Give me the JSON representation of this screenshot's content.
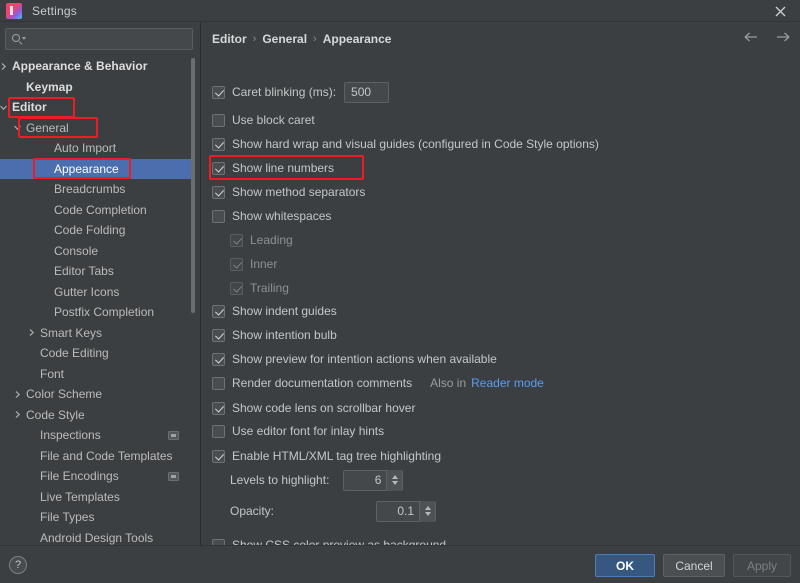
{
  "window": {
    "title": "Settings",
    "app_icon": "intellij-idea-icon",
    "close_icon": "close-icon"
  },
  "colors": {
    "background": "#3c3f41",
    "selection": "#4b6eaf",
    "accent_primary": "#365880",
    "link": "#589df6",
    "annotation": "#ee1c25",
    "text": "#c4c7c9"
  },
  "search": {
    "value": "",
    "placeholder": "",
    "icon": "search-icon"
  },
  "sidebar": {
    "items": [
      {
        "label": "Appearance & Behavior",
        "indent": 0,
        "chevron": "right",
        "bold": true,
        "selected": false,
        "badge": false
      },
      {
        "label": "Keymap",
        "indent": 1,
        "chevron": "",
        "bold": true,
        "selected": false,
        "badge": false
      },
      {
        "label": "Editor",
        "indent": 0,
        "chevron": "down",
        "bold": true,
        "selected": false,
        "badge": false
      },
      {
        "label": "General",
        "indent": 1,
        "chevron": "down",
        "bold": false,
        "selected": false,
        "badge": false
      },
      {
        "label": "Auto Import",
        "indent": 3,
        "chevron": "",
        "bold": false,
        "selected": false,
        "badge": false
      },
      {
        "label": "Appearance",
        "indent": 3,
        "chevron": "",
        "bold": false,
        "selected": true,
        "badge": false
      },
      {
        "label": "Breadcrumbs",
        "indent": 3,
        "chevron": "",
        "bold": false,
        "selected": false,
        "badge": false
      },
      {
        "label": "Code Completion",
        "indent": 3,
        "chevron": "",
        "bold": false,
        "selected": false,
        "badge": false
      },
      {
        "label": "Code Folding",
        "indent": 3,
        "chevron": "",
        "bold": false,
        "selected": false,
        "badge": false
      },
      {
        "label": "Console",
        "indent": 3,
        "chevron": "",
        "bold": false,
        "selected": false,
        "badge": false
      },
      {
        "label": "Editor Tabs",
        "indent": 3,
        "chevron": "",
        "bold": false,
        "selected": false,
        "badge": false
      },
      {
        "label": "Gutter Icons",
        "indent": 3,
        "chevron": "",
        "bold": false,
        "selected": false,
        "badge": false
      },
      {
        "label": "Postfix Completion",
        "indent": 3,
        "chevron": "",
        "bold": false,
        "selected": false,
        "badge": false
      },
      {
        "label": "Smart Keys",
        "indent": 2,
        "chevron": "right",
        "bold": false,
        "selected": false,
        "badge": false
      },
      {
        "label": "Code Editing",
        "indent": 2,
        "chevron": "",
        "bold": false,
        "selected": false,
        "badge": false
      },
      {
        "label": "Font",
        "indent": 2,
        "chevron": "",
        "bold": false,
        "selected": false,
        "badge": false
      },
      {
        "label": "Color Scheme",
        "indent": 1,
        "chevron": "right",
        "bold": false,
        "selected": false,
        "badge": false
      },
      {
        "label": "Code Style",
        "indent": 1,
        "chevron": "right",
        "bold": false,
        "selected": false,
        "badge": false
      },
      {
        "label": "Inspections",
        "indent": 2,
        "chevron": "",
        "bold": false,
        "selected": false,
        "badge": true
      },
      {
        "label": "File and Code Templates",
        "indent": 2,
        "chevron": "",
        "bold": false,
        "selected": false,
        "badge": false
      },
      {
        "label": "File Encodings",
        "indent": 2,
        "chevron": "",
        "bold": false,
        "selected": false,
        "badge": true
      },
      {
        "label": "Live Templates",
        "indent": 2,
        "chevron": "",
        "bold": false,
        "selected": false,
        "badge": false
      },
      {
        "label": "File Types",
        "indent": 2,
        "chevron": "",
        "bold": false,
        "selected": false,
        "badge": false
      },
      {
        "label": "Android Design Tools",
        "indent": 2,
        "chevron": "",
        "bold": false,
        "selected": false,
        "badge": false
      }
    ]
  },
  "breadcrumb": {
    "parts": [
      "Editor",
      "General",
      "Appearance"
    ],
    "separator": "›"
  },
  "nav": {
    "back_icon": "arrow-left-icon",
    "forward_icon": "arrow-right-icon"
  },
  "settings": {
    "rows": [
      {
        "id": "caret-blinking",
        "label": "Caret blinking (ms):",
        "checked": true,
        "enabled": true,
        "indent": 0,
        "control": "text",
        "value": "500"
      },
      {
        "id": "use-block-caret",
        "label": "Use block caret",
        "checked": false,
        "enabled": true,
        "indent": 0,
        "control": "none",
        "value": ""
      },
      {
        "id": "show-hard-wrap",
        "label": "Show hard wrap and visual guides (configured in Code Style options)",
        "checked": true,
        "enabled": true,
        "indent": 0,
        "control": "none",
        "value": ""
      },
      {
        "id": "show-line-numbers",
        "label": "Show line numbers",
        "checked": true,
        "enabled": true,
        "indent": 0,
        "control": "none",
        "value": ""
      },
      {
        "id": "show-method-separators",
        "label": "Show method separators",
        "checked": true,
        "enabled": true,
        "indent": 0,
        "control": "none",
        "value": ""
      },
      {
        "id": "show-whitespaces",
        "label": "Show whitespaces",
        "checked": false,
        "enabled": true,
        "indent": 0,
        "control": "none",
        "value": ""
      },
      {
        "id": "whitespace-leading",
        "label": "Leading",
        "checked": true,
        "enabled": false,
        "indent": 1,
        "control": "none",
        "value": ""
      },
      {
        "id": "whitespace-inner",
        "label": "Inner",
        "checked": true,
        "enabled": false,
        "indent": 1,
        "control": "none",
        "value": ""
      },
      {
        "id": "whitespace-trailing",
        "label": "Trailing",
        "checked": true,
        "enabled": false,
        "indent": 1,
        "control": "none",
        "value": ""
      },
      {
        "id": "show-indent-guides",
        "label": "Show indent guides",
        "checked": true,
        "enabled": true,
        "indent": 0,
        "control": "none",
        "value": ""
      },
      {
        "id": "show-intention-bulb",
        "label": "Show intention bulb",
        "checked": true,
        "enabled": true,
        "indent": 0,
        "control": "none",
        "value": ""
      },
      {
        "id": "show-preview-intention",
        "label": "Show preview for intention actions when available",
        "checked": true,
        "enabled": true,
        "indent": 0,
        "control": "none",
        "value": ""
      },
      {
        "id": "render-doc-comments",
        "label": "Render documentation comments",
        "checked": false,
        "enabled": true,
        "indent": 0,
        "control": "link",
        "value": ""
      },
      {
        "id": "show-code-lens",
        "label": "Show code lens on scrollbar hover",
        "checked": true,
        "enabled": true,
        "indent": 0,
        "control": "none",
        "value": ""
      },
      {
        "id": "use-editor-font-inlay",
        "label": "Use editor font for inlay hints",
        "checked": false,
        "enabled": true,
        "indent": 0,
        "control": "none",
        "value": ""
      },
      {
        "id": "enable-html-tag-tree",
        "label": "Enable HTML/XML tag tree highlighting",
        "checked": true,
        "enabled": true,
        "indent": 0,
        "control": "none",
        "value": ""
      },
      {
        "id": "show-css-color-preview",
        "label": "Show CSS color preview as background",
        "checked": false,
        "enabled": true,
        "indent": 0,
        "control": "none",
        "value": ""
      }
    ],
    "reader_mode": {
      "prefix": "Also in",
      "link_label": "Reader mode"
    },
    "levels_to_highlight": {
      "label": "Levels to highlight:",
      "value": "6"
    },
    "opacity": {
      "label": "Opacity:",
      "value": "0.1"
    }
  },
  "footer": {
    "help_label": "?",
    "ok_label": "OK",
    "cancel_label": "Cancel",
    "apply_label": "Apply"
  }
}
